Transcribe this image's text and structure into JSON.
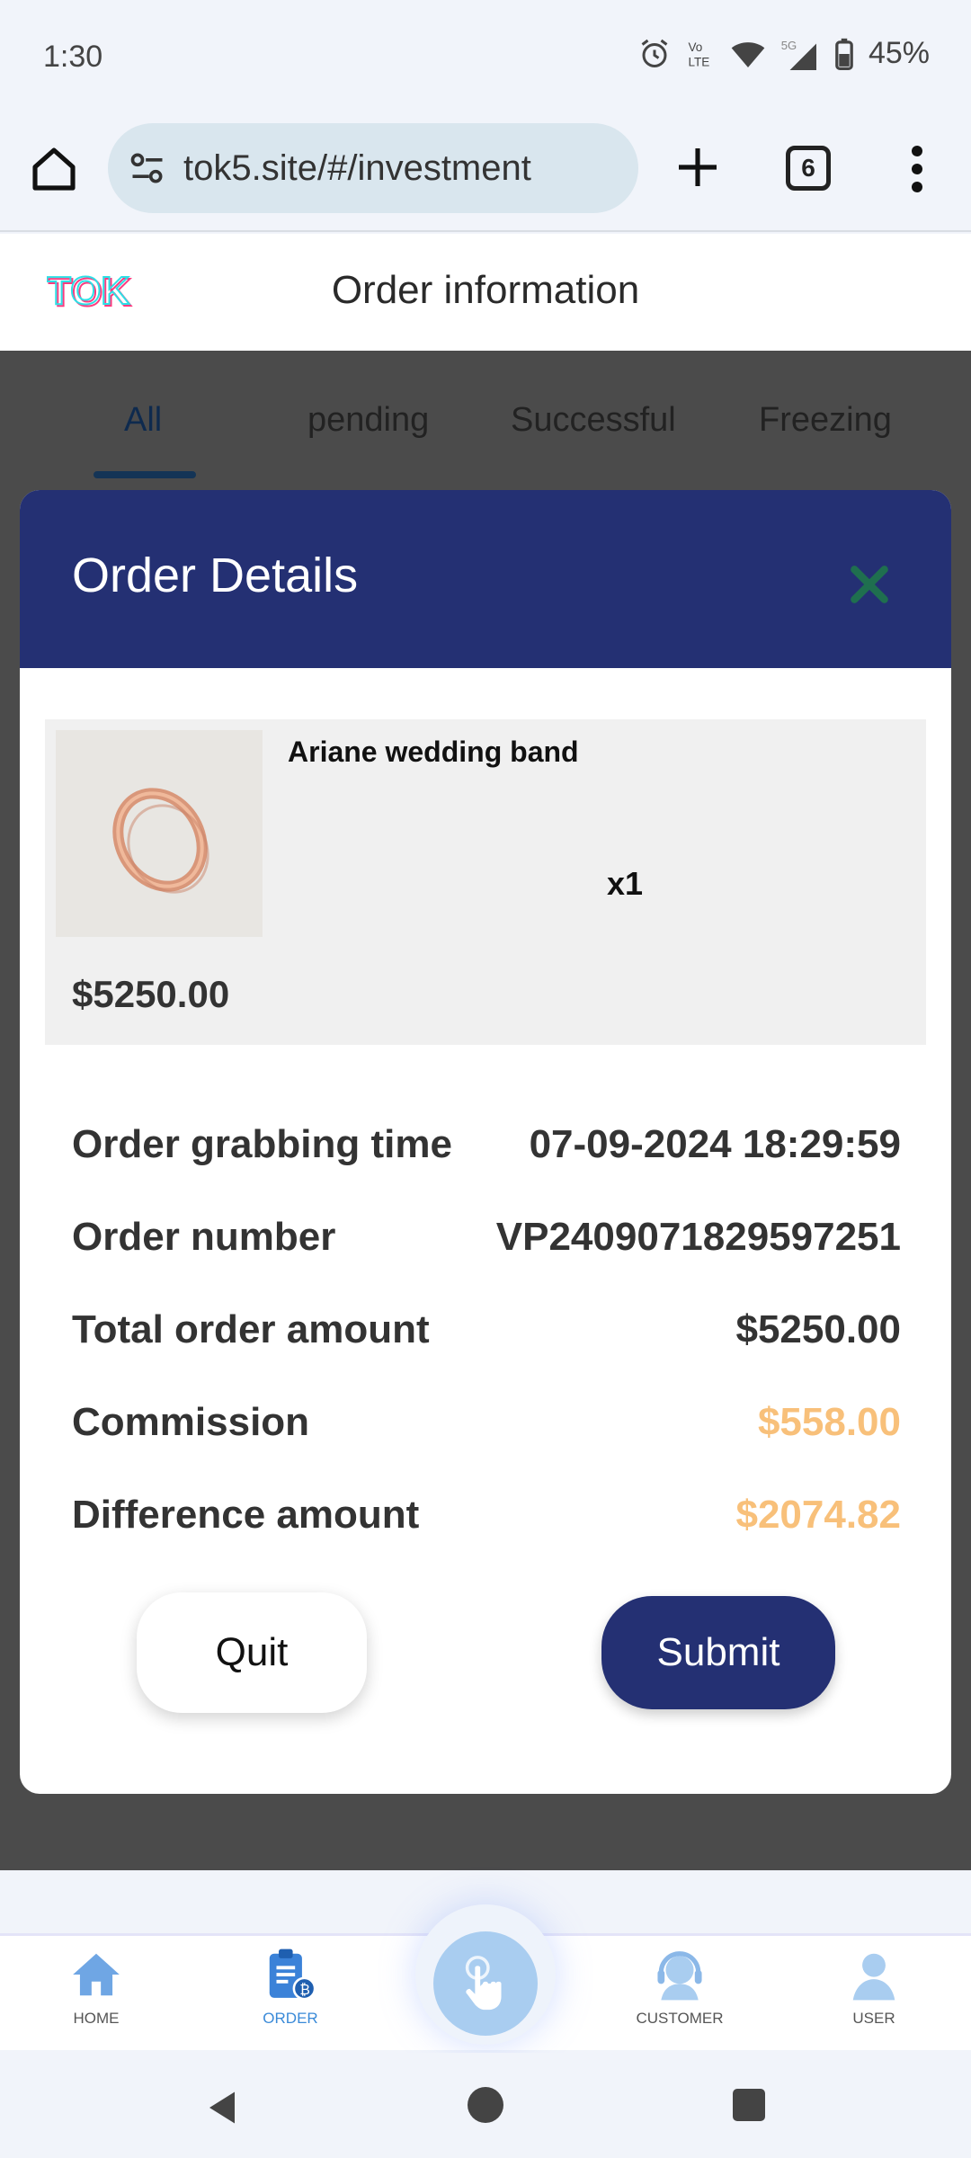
{
  "status_bar": {
    "time": "1:30",
    "battery": "45%",
    "icons": [
      "alarm-icon",
      "volte-icon",
      "wifi-icon",
      "signal-5g-icon",
      "battery-icon"
    ]
  },
  "browser": {
    "url": "tok5.site/#/investment",
    "tab_count": "6"
  },
  "app": {
    "title": "Order information",
    "logo_text": "TOK"
  },
  "tabs": [
    {
      "label": "All",
      "active": true
    },
    {
      "label": "pending",
      "active": false
    },
    {
      "label": "Successful",
      "active": false
    },
    {
      "label": "Freezing",
      "active": false
    }
  ],
  "modal": {
    "title": "Order Details",
    "product": {
      "name": "Ariane wedding band",
      "quantity": "x1",
      "price": "$5250.00"
    },
    "details": [
      {
        "label": "Order grabbing time",
        "value": "07-09-2024 18:29:59"
      },
      {
        "label": "Order number",
        "value": "VP2409071829597251"
      },
      {
        "label": "Total order amount",
        "value": "$5250.00"
      },
      {
        "label": "Commission",
        "value": "$558.00"
      },
      {
        "label": "Difference amount",
        "value": "$2074.82"
      }
    ],
    "quit_label": "Quit",
    "submit_label": "Submit"
  },
  "bottom_nav": [
    {
      "label": "HOME",
      "icon": "home-icon"
    },
    {
      "label": "ORDER",
      "icon": "order-icon",
      "active": true
    },
    {
      "label": "",
      "icon": "tap-hand-icon"
    },
    {
      "label": "CUSTOMER",
      "icon": "headset-icon"
    },
    {
      "label": "USER",
      "icon": "user-icon"
    }
  ],
  "colors": {
    "accent_navy": "#243073",
    "highlight_orange": "#f8c07a",
    "active_nav": "#3a8ad8"
  }
}
